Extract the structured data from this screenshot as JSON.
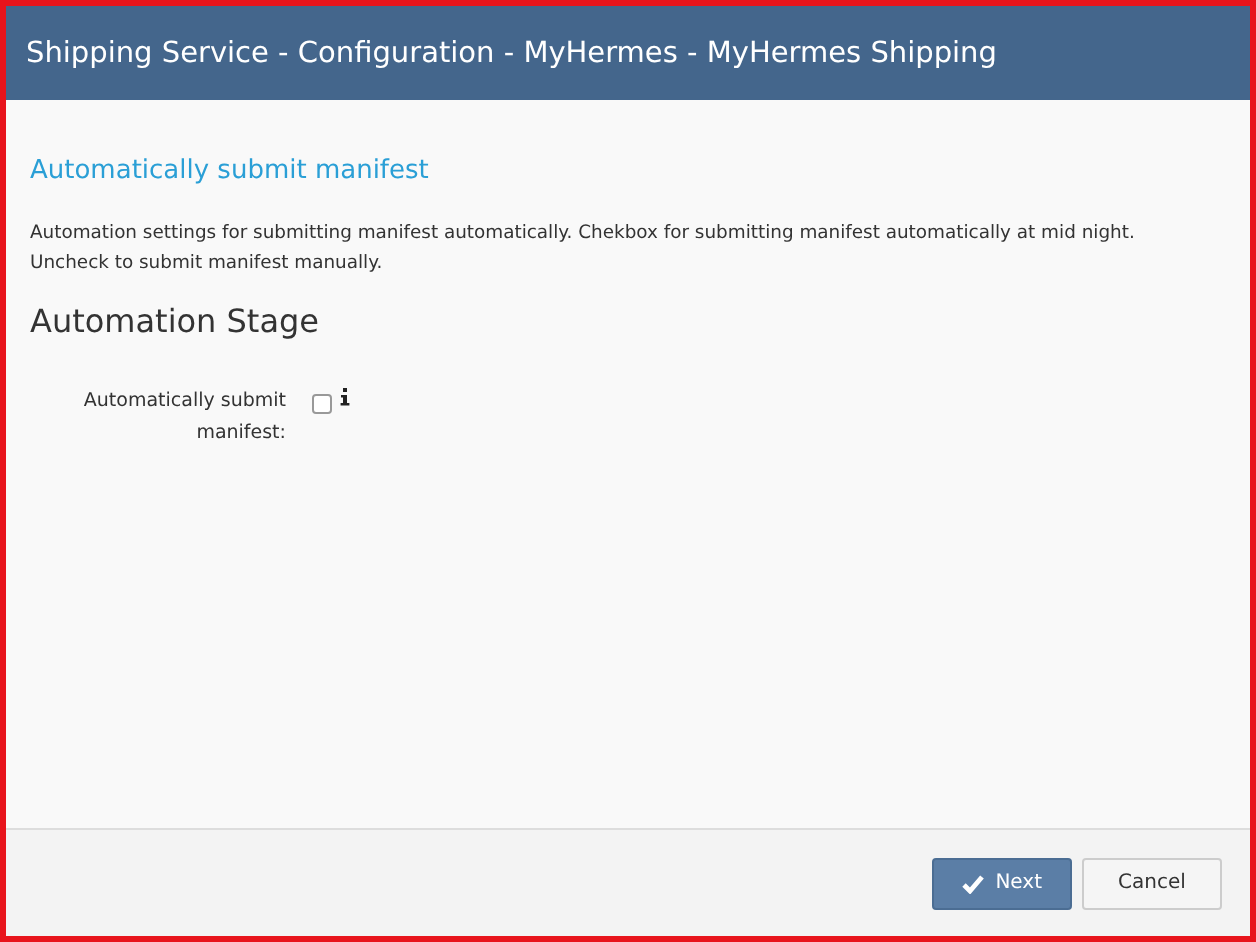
{
  "window": {
    "title": "Shipping Service - Configuration - MyHermes - MyHermes Shipping"
  },
  "section": {
    "title": "Automatically submit manifest",
    "description": "Automation settings for submitting manifest automatically. Chekbox for submitting manifest automatically at mid night. Uncheck to submit manifest manually."
  },
  "stage": {
    "heading": "Automation Stage",
    "fields": [
      {
        "label": "Automatically submit manifest:",
        "checked": false
      }
    ]
  },
  "buttons": [
    {
      "label": "Next",
      "kind": "primary"
    },
    {
      "label": "Cancel",
      "kind": "secondary"
    }
  ]
}
